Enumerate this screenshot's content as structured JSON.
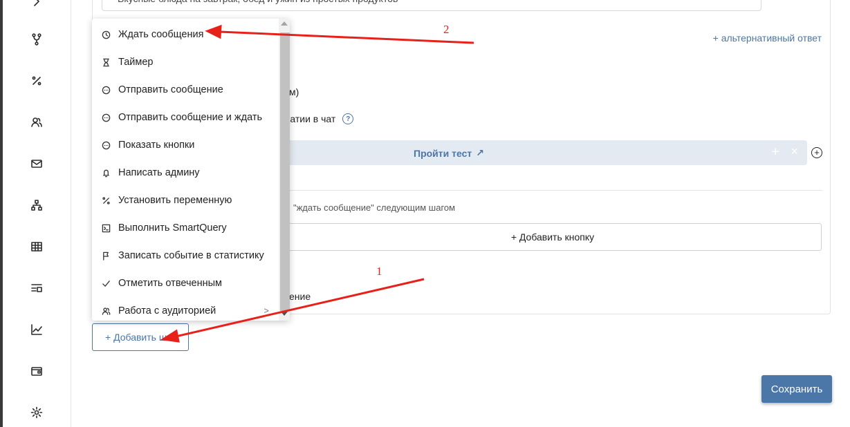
{
  "top_field": {
    "value": "Вкусные блюда на завтрак, обед и ужин из простых продуктов"
  },
  "alt_answer_link": "+ альтернативный ответ",
  "partial_texts": {
    "line1": "м)",
    "line2": "жатии в чат",
    "line3": "ение"
  },
  "help_icon_glyph": "?",
  "inline_button": {
    "label": "Пройти тест",
    "arrow_glyph": "↗",
    "plus_glyph": "+",
    "close_glyph": "×"
  },
  "add_row_glyph": "+",
  "hint_text": "\"ждать сообщение\" следующим шагом",
  "add_button_label": "+ Добавить кнопку",
  "add_step_label": "+ Добавить шаг",
  "save_label": "Сохранить",
  "menu": {
    "items": [
      {
        "label": "Ждать сообщения",
        "icon": "clock-icon"
      },
      {
        "label": "Таймер",
        "icon": "hourglass-icon"
      },
      {
        "label": "Отправить сообщение",
        "icon": "message-icon"
      },
      {
        "label": "Отправить сообщение и ждать",
        "icon": "message-icon"
      },
      {
        "label": "Показать кнопки",
        "icon": "message-icon"
      },
      {
        "label": "Написать админу",
        "icon": "bell-icon"
      },
      {
        "label": "Установить переменную",
        "icon": "percent-icon"
      },
      {
        "label": "Выполнить SmartQuery",
        "icon": "terminal-icon"
      },
      {
        "label": "Записать событие в статистику",
        "icon": "flag-icon"
      },
      {
        "label": "Отметить отвеченным",
        "icon": "check-icon"
      },
      {
        "label": "Работа с аудиторией",
        "icon": "users-icon",
        "submenu_glyph": ">"
      }
    ]
  },
  "sidebar": {
    "icons": [
      "play-icon",
      "branch-icon",
      "percent-icon",
      "users-icon",
      "mail-icon",
      "hierarchy-icon",
      "table-icon",
      "list-icon",
      "chart-icon",
      "wallet-icon",
      "gear-icon"
    ]
  },
  "annotations": {
    "label1": "1",
    "label2": "2",
    "color": "#e8201a"
  },
  "colors": {
    "accent": "#4a76a8",
    "inline_button_bg": "#e4eaf1"
  }
}
